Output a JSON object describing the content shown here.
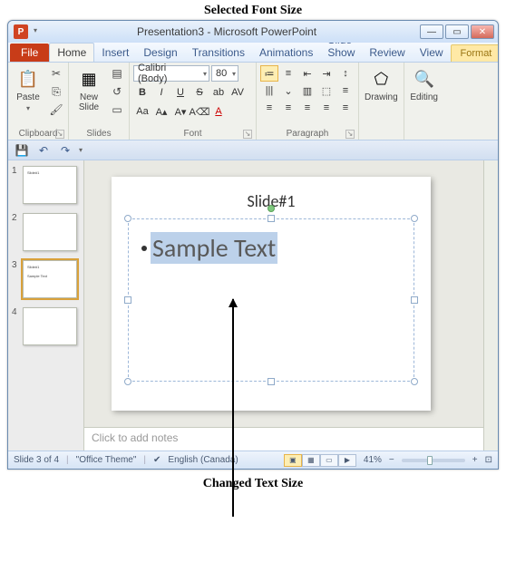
{
  "annotations": {
    "top": "Selected Font Size",
    "bottom": "Changed Text Size"
  },
  "window": {
    "title": "Presentation3 - Microsoft PowerPoint"
  },
  "menu": {
    "file": "File",
    "tabs": [
      "Home",
      "Insert",
      "Design",
      "Transitions",
      "Animations",
      "Slide Show",
      "Review",
      "View"
    ],
    "active_tab_index": 0,
    "context_tab": "Format"
  },
  "ribbon": {
    "clipboard": {
      "label": "Clipboard",
      "paste": "Paste"
    },
    "slides": {
      "label": "Slides",
      "new_slide": "New\nSlide"
    },
    "font": {
      "label": "Font",
      "name": "Calibri (Body)",
      "size": "80"
    },
    "paragraph": {
      "label": "Paragraph"
    },
    "drawing": {
      "label": "Drawing"
    },
    "editing": {
      "label": "Editing"
    }
  },
  "thumbnails": [
    {
      "num": "1",
      "title": "Slide#1",
      "body": ""
    },
    {
      "num": "2",
      "title": "",
      "body": ""
    },
    {
      "num": "3",
      "title": "Slide#1",
      "body": "Sample Text",
      "selected": true
    },
    {
      "num": "4",
      "title": "",
      "body": ""
    }
  ],
  "slide": {
    "title": "Slide#1",
    "bullet_text": "Sample Text"
  },
  "notes": {
    "placeholder": "Click to add notes"
  },
  "status": {
    "slide_info": "Slide 3 of 4",
    "theme": "\"Office Theme\"",
    "language": "English (Canada)",
    "zoom": "41%"
  }
}
